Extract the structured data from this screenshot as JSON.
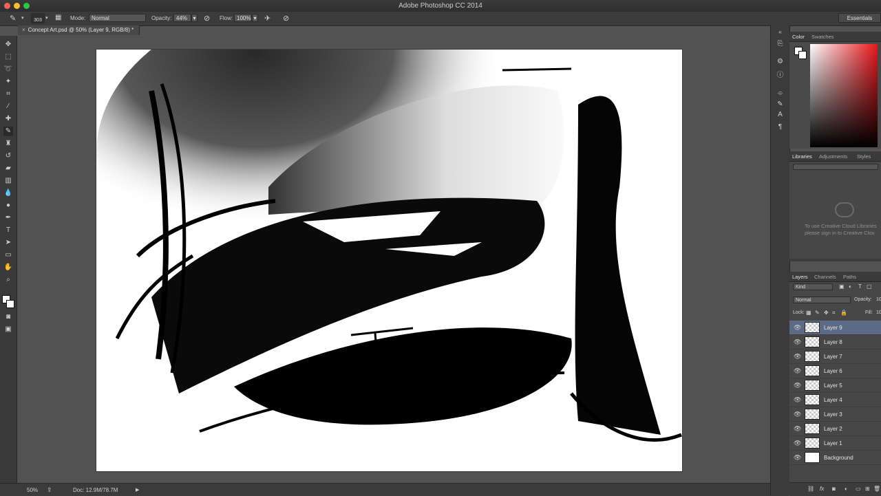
{
  "app": {
    "title": "Adobe Photoshop CC 2014"
  },
  "options": {
    "brush_size": "303",
    "mode_label": "Mode:",
    "mode_value": "Normal",
    "opacity_label": "Opacity:",
    "opacity_value": "44%",
    "flow_label": "Flow:",
    "flow_value": "100%",
    "workspace": "Essentials"
  },
  "document": {
    "tab_title": "Concept Art.psd @ 50% (Layer 9, RGB/8) *"
  },
  "status": {
    "zoom": "50%",
    "doc_size": "Doc: 12.9M/78.7M"
  },
  "color_panel": {
    "tabs": [
      "Color",
      "Swatches"
    ],
    "hue_color": "#e8161c"
  },
  "libraries_panel": {
    "tabs": [
      "Libraries",
      "Adjustments",
      "Styles"
    ],
    "message_line1": "To use Creative Cloud Libraries",
    "message_line2": "please sign in to Creative Clou"
  },
  "layers_panel": {
    "tabs": [
      "Layers",
      "Channels",
      "Paths"
    ],
    "filter_kind": "Kind",
    "blend_mode": "Normal",
    "opacity_label": "Opacity:",
    "opacity_value": "10",
    "lock_label": "Lock:",
    "fill_label": "Fill:",
    "fill_value": "10",
    "layers": [
      {
        "name": "Layer 9",
        "selected": true
      },
      {
        "name": "Layer 8",
        "selected": false
      },
      {
        "name": "Layer 7",
        "selected": false
      },
      {
        "name": "Layer 6",
        "selected": false
      },
      {
        "name": "Layer 5",
        "selected": false
      },
      {
        "name": "Layer 4",
        "selected": false
      },
      {
        "name": "Layer 3",
        "selected": false
      },
      {
        "name": "Layer 2",
        "selected": false
      },
      {
        "name": "Layer 1",
        "selected": false
      },
      {
        "name": "Background",
        "selected": false
      }
    ]
  }
}
